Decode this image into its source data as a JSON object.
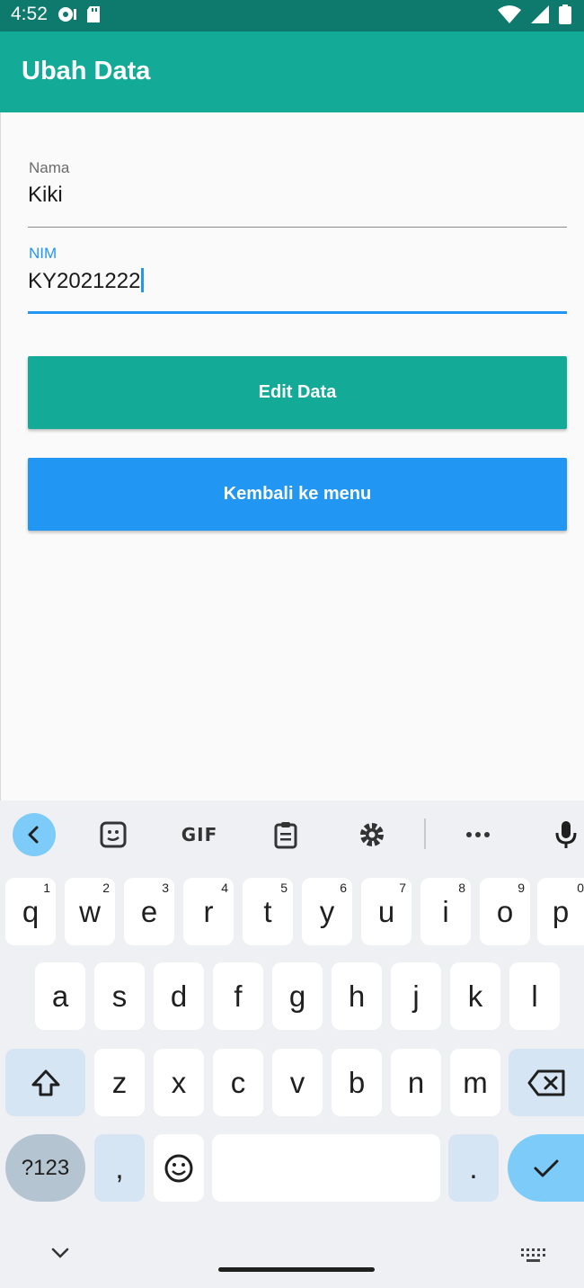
{
  "status_bar": {
    "time": "4:52",
    "icons_left": [
      "settings-circle-icon",
      "sd-card-icon"
    ],
    "icons_right": [
      "wifi-icon",
      "cellular-signal-icon",
      "battery-icon"
    ]
  },
  "app_bar": {
    "title": "Ubah Data",
    "color": "#13ab97"
  },
  "form": {
    "nama": {
      "label": "Nama",
      "value": "Kiki"
    },
    "nim": {
      "label": "NIM",
      "value": "KY2021222"
    }
  },
  "buttons": {
    "edit_label": "Edit Data",
    "back_label": "Kembali ke menu"
  },
  "keyboard": {
    "toolbar_icons": [
      "chevron-left-icon",
      "sticker-icon",
      "gif-icon",
      "clipboard-icon",
      "gear-icon",
      "more-icon",
      "mic-icon"
    ],
    "gif_label": "GIF",
    "row1": [
      {
        "k": "q",
        "h": "1"
      },
      {
        "k": "w",
        "h": "2"
      },
      {
        "k": "e",
        "h": "3"
      },
      {
        "k": "r",
        "h": "4"
      },
      {
        "k": "t",
        "h": "5"
      },
      {
        "k": "y",
        "h": "6"
      },
      {
        "k": "u",
        "h": "7"
      },
      {
        "k": "i",
        "h": "8"
      },
      {
        "k": "o",
        "h": "9"
      },
      {
        "k": "p",
        "h": "0"
      }
    ],
    "row2": [
      "a",
      "s",
      "d",
      "f",
      "g",
      "h",
      "j",
      "k",
      "l"
    ],
    "row3": [
      "z",
      "x",
      "c",
      "v",
      "b",
      "n",
      "m"
    ],
    "sym_label": "?123",
    "comma": ",",
    "period": "."
  }
}
